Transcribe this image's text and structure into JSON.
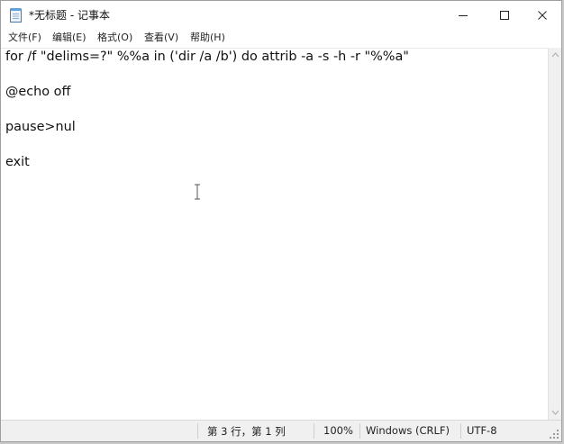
{
  "window": {
    "title": "*无标题 - 记事本"
  },
  "menu": [
    {
      "label": "文件(F)"
    },
    {
      "label": "编辑(E)"
    },
    {
      "label": "格式(O)"
    },
    {
      "label": "查看(V)"
    },
    {
      "label": "帮助(H)"
    }
  ],
  "editor": {
    "lines": [
      "for /f \"delims=?\" %%a in ('dir /a /b') do attrib -a -s -h -r \"%%a\"",
      "",
      "@echo off",
      "",
      "pause>nul",
      "",
      "exit"
    ]
  },
  "status": {
    "position": "第 3 行，第 1 列",
    "zoom": "100%",
    "line_ending": "Windows (CRLF)",
    "encoding": "UTF-8"
  }
}
